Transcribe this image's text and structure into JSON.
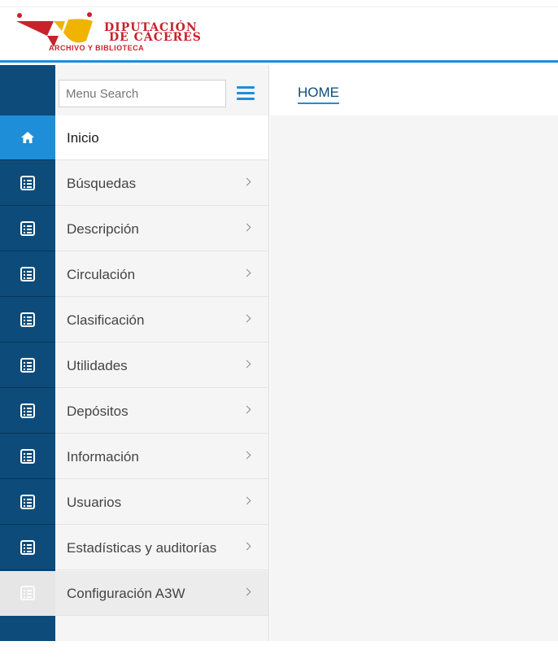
{
  "header": {
    "logo": {
      "line1": "DIPUTACIÓN",
      "line2": "DE CÁCERES",
      "subtitle": "ARCHIVO Y BIBLIOTECA"
    },
    "colors": {
      "accent": "#1f8ed8",
      "brand_red": "#c8222b",
      "rail": "#0d4c7a"
    }
  },
  "search": {
    "placeholder": "Menu Search"
  },
  "breadcrumb": {
    "label": "HOME"
  },
  "menu": {
    "items": [
      {
        "label": "Inicio",
        "icon": "home-icon",
        "state": "active"
      },
      {
        "label": "Búsquedas",
        "icon": "list-icon"
      },
      {
        "label": "Descripción",
        "icon": "list-icon"
      },
      {
        "label": "Circulación",
        "icon": "list-icon"
      },
      {
        "label": "Clasificación",
        "icon": "list-icon"
      },
      {
        "label": "Utilidades",
        "icon": "list-icon"
      },
      {
        "label": "Depósitos",
        "icon": "list-icon"
      },
      {
        "label": "Información",
        "icon": "list-icon"
      },
      {
        "label": "Usuarios",
        "icon": "list-icon"
      },
      {
        "label": "Estadísticas y auditorías",
        "icon": "list-icon"
      },
      {
        "label": "Configuración A3W",
        "icon": "list-icon",
        "state": "disabled"
      }
    ]
  }
}
